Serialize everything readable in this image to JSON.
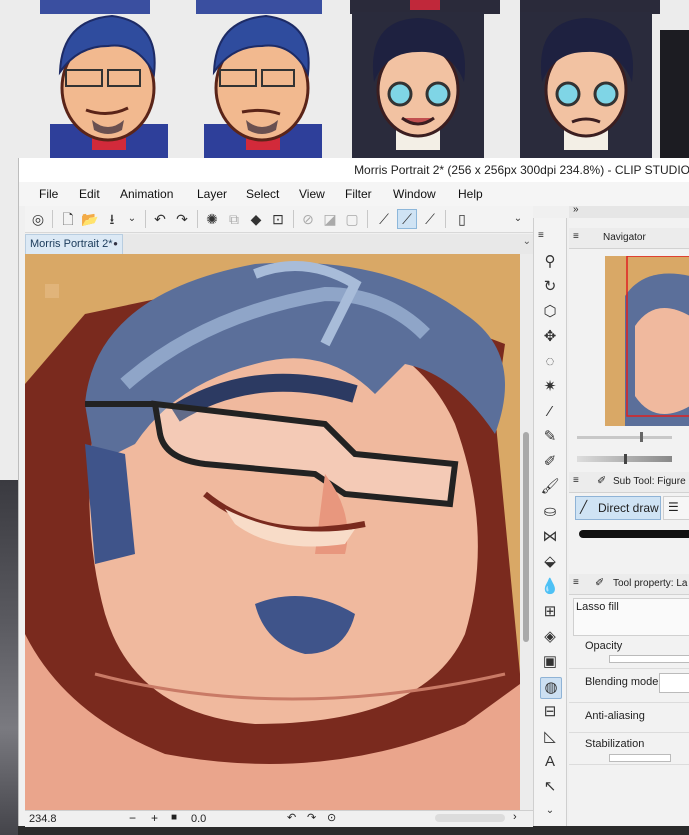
{
  "window": {
    "title": "Morris Portrait 2* (256 x 256px 300dpi 234.8%)  - CLIP STUDIO"
  },
  "menu": [
    "File",
    "Edit",
    "Animation",
    "Layer",
    "Select",
    "View",
    "Filter",
    "Window",
    "Help"
  ],
  "canvas_tab": {
    "label": "Morris Portrait 2*"
  },
  "status": {
    "zoom": "234.8",
    "angle": "0.0"
  },
  "panels": {
    "navigator": "Navigator",
    "sub_tool": "Sub Tool: Figure",
    "direct_draw": "Direct draw",
    "tool_property": "Tool property: La",
    "lasso_fill": "Lasso fill",
    "opacity": "Opacity",
    "blending_mode": "Blending mode",
    "anti_aliasing": "Anti-aliasing",
    "stabilization": "Stabilization"
  },
  "colors": {
    "accent": "#cfe3f4",
    "skin": "#f0b99e",
    "hair": "#5b6f9a",
    "outline": "#7a2a1e",
    "background": "#d9a866"
  }
}
